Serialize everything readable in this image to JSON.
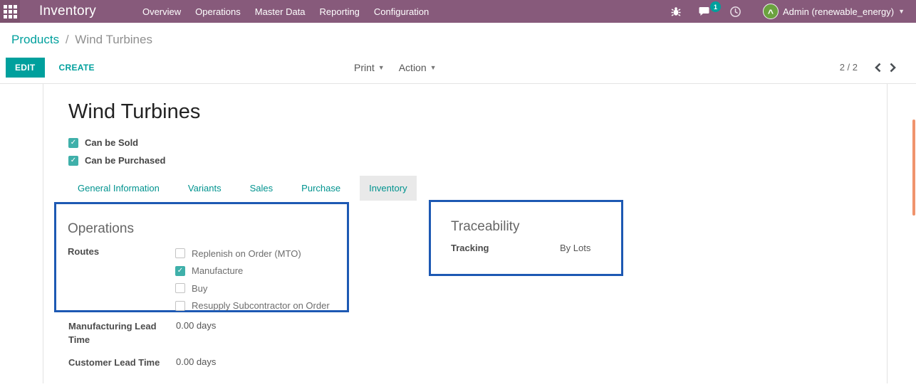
{
  "colors": {
    "topbar_bg": "#875a7b",
    "accent_teal": "#00a09d",
    "annotation_blue": "#1d59b3",
    "scrollbar_orange": "#f0936c",
    "avatar_green": "#6ba23f"
  },
  "icons": {
    "apps": "apps-grid-icon (3x3 white squares)",
    "debug": "bug-icon",
    "messages": "chat-bubble-icon",
    "activities": "clock-icon",
    "user_caret": "▾",
    "pager_prev": "chevron-left",
    "pager_next": "chevron-right"
  },
  "topbar": {
    "app_name": "Inventory",
    "menu_items": [
      "Overview",
      "Operations",
      "Master Data",
      "Reporting",
      "Configuration"
    ],
    "message_badge": "1",
    "user": "Admin (renewable_energy)"
  },
  "breadcrumb": {
    "parent": "Products",
    "separator": "/",
    "current": "Wind Turbines"
  },
  "control_panel": {
    "edit_label": "EDIT",
    "create_label": "CREATE",
    "print_label": "Print",
    "action_label": "Action",
    "pager": "2 / 2"
  },
  "form": {
    "title": "Wind Turbines",
    "flags": [
      {
        "label": "Can be Sold",
        "checked": true
      },
      {
        "label": "Can be Purchased",
        "checked": true
      }
    ],
    "tabs": [
      {
        "label": "General Information",
        "active": false
      },
      {
        "label": "Variants",
        "active": false
      },
      {
        "label": "Sales",
        "active": false
      },
      {
        "label": "Purchase",
        "active": false
      },
      {
        "label": "Inventory",
        "active": true
      }
    ],
    "operations": {
      "heading": "Operations",
      "routes_label": "Routes",
      "routes": [
        {
          "label": "Replenish on Order (MTO)",
          "checked": false
        },
        {
          "label": "Manufacture",
          "checked": true
        },
        {
          "label": "Buy",
          "checked": false
        },
        {
          "label": "Resupply Subcontractor on Order",
          "checked": false
        }
      ]
    },
    "traceability": {
      "heading": "Traceability",
      "tracking_label": "Tracking",
      "tracking_value": "By Lots"
    },
    "lead_times": [
      {
        "label": "Manufacturing Lead Time",
        "value": "0.00 days"
      },
      {
        "label": "Customer Lead Time",
        "value": "0.00 days"
      }
    ]
  }
}
